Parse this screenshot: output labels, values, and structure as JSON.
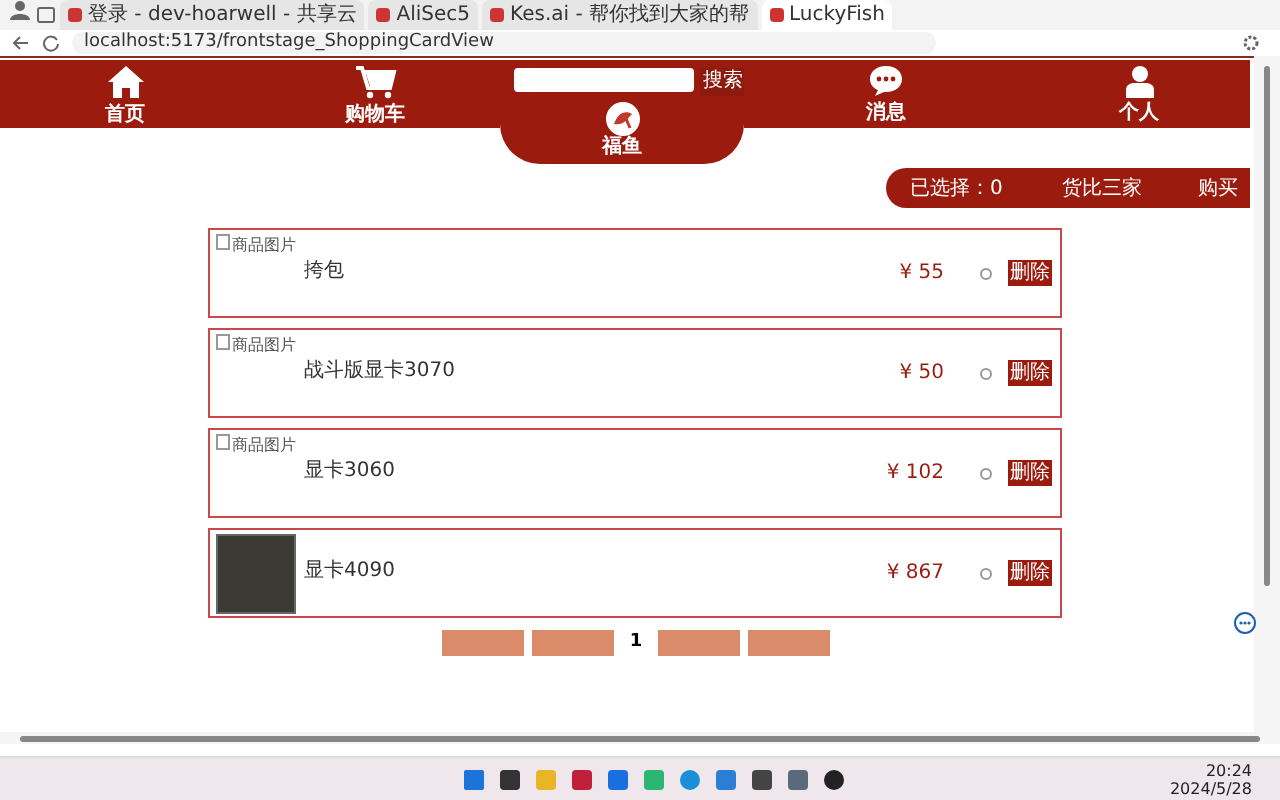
{
  "browser": {
    "tabs": [
      {
        "title": "登录 - dev-hoarwell - 共享云",
        "selected": false
      },
      {
        "title": "AliSec5",
        "selected": false
      },
      {
        "title": "Kes.ai - 帮你找到大家的帮",
        "selected": false
      },
      {
        "title": "LuckyFish",
        "selected": true
      }
    ],
    "address": "localhost:5173/frontstage_ShoppingCardView"
  },
  "nav": {
    "items": [
      {
        "label": "首页",
        "kind": "home"
      },
      {
        "label": "购物车",
        "kind": "cart"
      },
      {
        "label": "消息",
        "kind": "chat"
      },
      {
        "label": "个人",
        "kind": "person"
      }
    ],
    "search_button": "搜索",
    "logo": "福鱼"
  },
  "selection_bar": {
    "selected_count": "已选择：0",
    "compare": "货比三家",
    "buy": "购买"
  },
  "cart_items": [
    {
      "kind": "broken-image",
      "image_alt": "商品图片",
      "name": "挎包",
      "price": "¥ 55",
      "checked": false,
      "delete": "删除"
    },
    {
      "kind": "broken-image",
      "image_alt": "商品图片",
      "name": "战斗版显卡3070",
      "price": "¥ 50",
      "checked": false,
      "delete": "删除"
    },
    {
      "kind": "broken-image",
      "image_alt": "商品图片",
      "name": "显卡3060",
      "price": "¥ 102",
      "checked": false,
      "delete": "删除"
    },
    {
      "kind": "photo",
      "name": "显卡4090",
      "price": "¥ 867",
      "checked": false,
      "delete": "删除"
    }
  ],
  "pagination": {
    "current_page": "1"
  },
  "taskbar": {
    "time": "20:24",
    "date": "2024/5/28"
  }
}
